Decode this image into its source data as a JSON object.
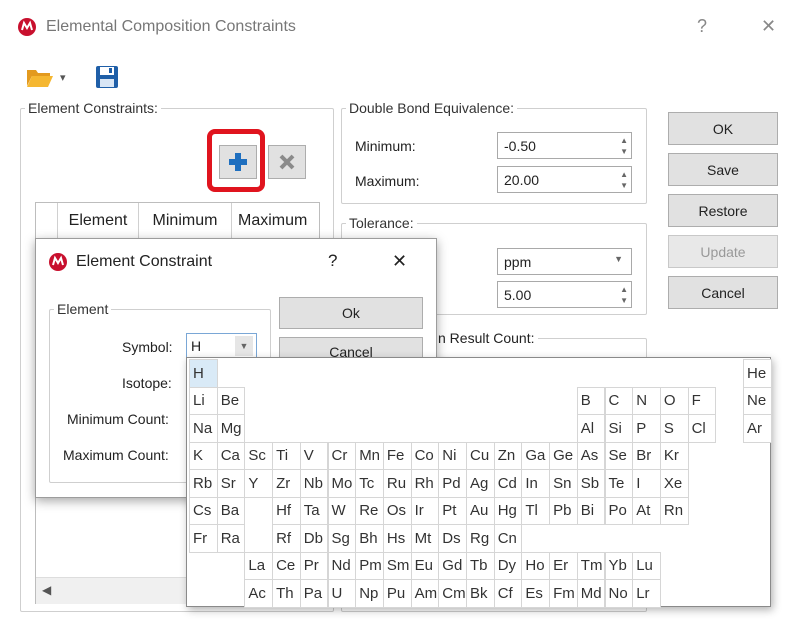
{
  "window": {
    "title": "Elemental Composition Constraints",
    "help": "?",
    "close": "✕"
  },
  "toolbar": {
    "open_icon": "folder-open-icon",
    "dropdown_arrow": "▾",
    "save_icon": "floppy-disk-icon"
  },
  "element_constraints": {
    "legend": "Element Constraints:",
    "columns": [
      "Element",
      "Minimum",
      "Maximum"
    ],
    "add_icon": "plus-icon",
    "remove_icon": "x-icon",
    "scroll_left": "◀"
  },
  "dbe": {
    "legend": "Double Bond Equivalence:",
    "min_label": "Minimum:",
    "min_value": "-0.50",
    "max_label": "Maximum:",
    "max_value": "20.00"
  },
  "tolerance": {
    "legend": "Tolerance:",
    "unit_value": "ppm",
    "value": "5.00"
  },
  "result_count": {
    "legend_partial": "n Result Count:"
  },
  "buttons": {
    "ok": "OK",
    "save": "Save",
    "restore": "Restore",
    "update": "Update",
    "cancel": "Cancel"
  },
  "dialog": {
    "title": "Element Constraint",
    "help": "?",
    "close": "✕",
    "group_legend": "Element",
    "symbol_label": "Symbol:",
    "symbol_value": "H",
    "isotope_label": "Isotope:",
    "min_count_label": "Minimum Count:",
    "max_count_label": "Maximum Count:",
    "ok_button": "Ok",
    "cancel_button": "Cancel"
  },
  "periodic_table": {
    "selected": "H",
    "elements": [
      [
        "H",
        0,
        0
      ],
      [
        "He",
        20,
        0
      ],
      [
        "Li",
        0,
        1
      ],
      [
        "Be",
        1,
        1
      ],
      [
        "B",
        14,
        1
      ],
      [
        "C",
        15,
        1
      ],
      [
        "N",
        16,
        1
      ],
      [
        "O",
        17,
        1
      ],
      [
        "F",
        18,
        1
      ],
      [
        "Ne",
        20,
        1
      ],
      [
        "Na",
        0,
        2
      ],
      [
        "Mg",
        1,
        2
      ],
      [
        "Al",
        14,
        2
      ],
      [
        "Si",
        15,
        2
      ],
      [
        "P",
        16,
        2
      ],
      [
        "S",
        17,
        2
      ],
      [
        "Cl",
        18,
        2
      ],
      [
        "Ar",
        20,
        2
      ],
      [
        "K",
        0,
        3
      ],
      [
        "Ca",
        1,
        3
      ],
      [
        "Sc",
        2,
        3
      ],
      [
        "Ti",
        3,
        3
      ],
      [
        "V",
        4,
        3
      ],
      [
        "Cr",
        5,
        3
      ],
      [
        "Mn",
        6,
        3
      ],
      [
        "Fe",
        7,
        3
      ],
      [
        "Co",
        8,
        3
      ],
      [
        "Ni",
        9,
        3
      ],
      [
        "Cu",
        10,
        3
      ],
      [
        "Zn",
        11,
        3
      ],
      [
        "Ga",
        12,
        3
      ],
      [
        "Ge",
        13,
        3
      ],
      [
        "As",
        14,
        3
      ],
      [
        "Se",
        15,
        3
      ],
      [
        "Br",
        16,
        3
      ],
      [
        "Kr",
        17,
        3
      ],
      [
        "Rb",
        0,
        4
      ],
      [
        "Sr",
        1,
        4
      ],
      [
        "Y",
        2,
        4
      ],
      [
        "Zr",
        3,
        4
      ],
      [
        "Nb",
        4,
        4
      ],
      [
        "Mo",
        5,
        4
      ],
      [
        "Tc",
        6,
        4
      ],
      [
        "Ru",
        7,
        4
      ],
      [
        "Rh",
        8,
        4
      ],
      [
        "Pd",
        9,
        4
      ],
      [
        "Ag",
        10,
        4
      ],
      [
        "Cd",
        11,
        4
      ],
      [
        "In",
        12,
        4
      ],
      [
        "Sn",
        13,
        4
      ],
      [
        "Sb",
        14,
        4
      ],
      [
        "Te",
        15,
        4
      ],
      [
        "I",
        16,
        4
      ],
      [
        "Xe",
        17,
        4
      ],
      [
        "Cs",
        0,
        5
      ],
      [
        "Ba",
        1,
        5
      ],
      [
        "Hf",
        3,
        5
      ],
      [
        "Ta",
        4,
        5
      ],
      [
        "W",
        5,
        5
      ],
      [
        "Re",
        6,
        5
      ],
      [
        "Os",
        7,
        5
      ],
      [
        "Ir",
        8,
        5
      ],
      [
        "Pt",
        9,
        5
      ],
      [
        "Au",
        10,
        5
      ],
      [
        "Hg",
        11,
        5
      ],
      [
        "Tl",
        12,
        5
      ],
      [
        "Pb",
        13,
        5
      ],
      [
        "Bi",
        14,
        5
      ],
      [
        "Po",
        15,
        5
      ],
      [
        "At",
        16,
        5
      ],
      [
        "Rn",
        17,
        5
      ],
      [
        "Fr",
        0,
        6
      ],
      [
        "Ra",
        1,
        6
      ],
      [
        "Rf",
        3,
        6
      ],
      [
        "Db",
        4,
        6
      ],
      [
        "Sg",
        5,
        6
      ],
      [
        "Bh",
        6,
        6
      ],
      [
        "Hs",
        7,
        6
      ],
      [
        "Mt",
        8,
        6
      ],
      [
        "Ds",
        9,
        6
      ],
      [
        "Rg",
        10,
        6
      ],
      [
        "Cn",
        11,
        6
      ],
      [
        "La",
        2,
        7
      ],
      [
        "Ce",
        3,
        7
      ],
      [
        "Pr",
        4,
        7
      ],
      [
        "Nd",
        5,
        7
      ],
      [
        "Pm",
        6,
        7
      ],
      [
        "Sm",
        7,
        7
      ],
      [
        "Eu",
        8,
        7
      ],
      [
        "Gd",
        9,
        7
      ],
      [
        "Tb",
        10,
        7
      ],
      [
        "Dy",
        11,
        7
      ],
      [
        "Ho",
        12,
        7
      ],
      [
        "Er",
        13,
        7
      ],
      [
        "Tm",
        14,
        7
      ],
      [
        "Yb",
        15,
        7
      ],
      [
        "Lu",
        16,
        7
      ],
      [
        "Ac",
        2,
        8
      ],
      [
        "Th",
        3,
        8
      ],
      [
        "Pa",
        4,
        8
      ],
      [
        "U",
        5,
        8
      ],
      [
        "Np",
        6,
        8
      ],
      [
        "Pu",
        7,
        8
      ],
      [
        "Am",
        8,
        8
      ],
      [
        "Cm",
        9,
        8
      ],
      [
        "Bk",
        10,
        8
      ],
      [
        "Cf",
        11,
        8
      ],
      [
        "Es",
        12,
        8
      ],
      [
        "Fm",
        13,
        8
      ],
      [
        "Md",
        14,
        8
      ],
      [
        "No",
        15,
        8
      ],
      [
        "Lr",
        16,
        8
      ]
    ]
  },
  "colors": {
    "accent_blue": "#1f6fbf",
    "highlight_red": "#e0141e",
    "app_logo_red": "#c8102e"
  }
}
